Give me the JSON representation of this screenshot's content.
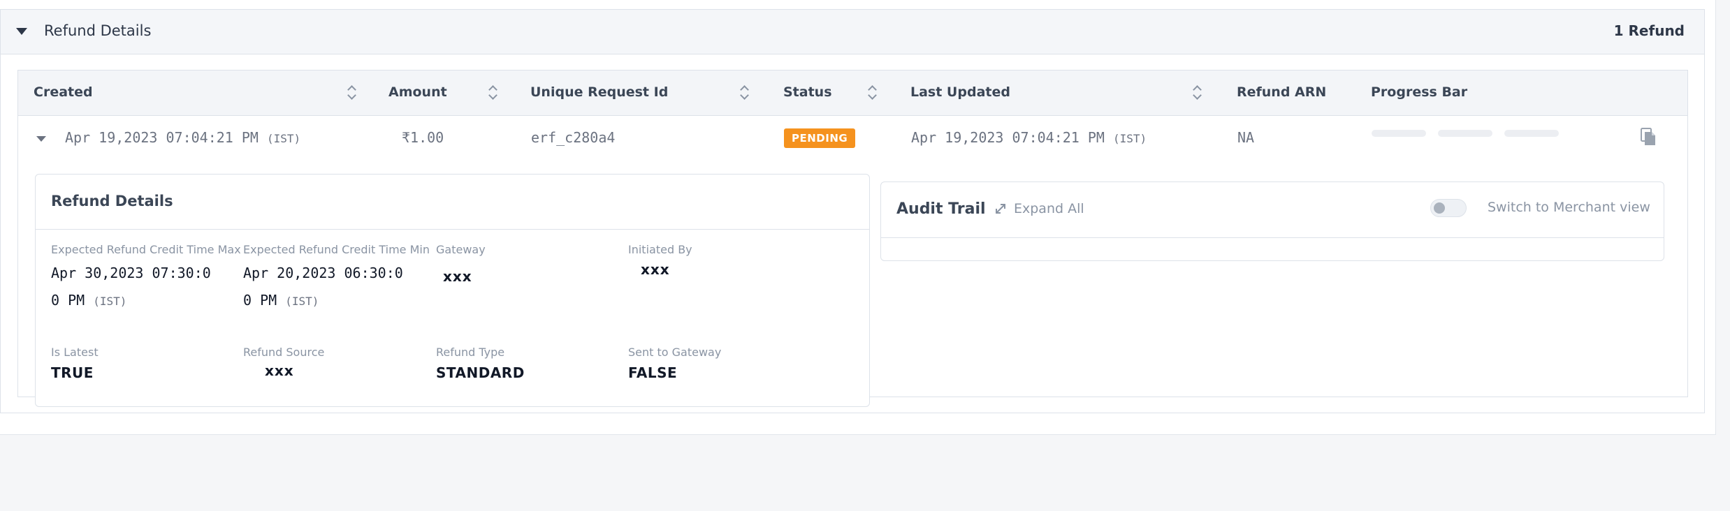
{
  "panel": {
    "title": "Refund Details",
    "count_label": "1 Refund"
  },
  "table": {
    "headers": {
      "created": "Created",
      "amount": "Amount",
      "request_id": "Unique Request Id",
      "status": "Status",
      "last_updated": "Last Updated",
      "arn": "Refund ARN",
      "progress": "Progress Bar"
    },
    "row": {
      "created": "Apr 19,2023 07:04:21 PM",
      "created_tz": "(IST)",
      "amount": "₹1.00",
      "request_id": "erf_c280a4",
      "status": "PENDING",
      "last_updated": "Apr 19,2023 07:04:21 PM",
      "last_updated_tz": "(IST)",
      "arn": "NA"
    }
  },
  "details": {
    "title": "Refund Details",
    "expected_max_label": "Expected Refund Credit Time Max",
    "expected_max_line1": "Apr 30,2023 07:30:0",
    "expected_max_line2": "0 PM",
    "expected_max_tz": "(IST)",
    "expected_min_label": "Expected Refund Credit Time Min",
    "expected_min_line1": "Apr 20,2023 06:30:0",
    "expected_min_line2": "0 PM",
    "expected_min_tz": "(IST)",
    "gateway_label": "Gateway",
    "gateway_value": "xxx",
    "initiated_by_label": "Initiated By",
    "initiated_by_value": "xxx",
    "is_latest_label": "Is Latest",
    "is_latest_value": "TRUE",
    "refund_source_label": "Refund Source",
    "refund_source_value": "xxx",
    "refund_type_label": "Refund Type",
    "refund_type_value": "STANDARD",
    "sent_to_gateway_label": "Sent to Gateway",
    "sent_to_gateway_value": "FALSE"
  },
  "audit": {
    "title": "Audit Trail",
    "expand_label": "Expand All",
    "toggle_label": "Switch to Merchant view"
  },
  "colors": {
    "status_pending": "#f5921e",
    "heading": "#3b4656",
    "muted": "#8a94a3"
  },
  "icons": {
    "panel_caret": "caret-down-icon",
    "copy": "copy-icon",
    "expand": "expand-arrows-icon"
  }
}
